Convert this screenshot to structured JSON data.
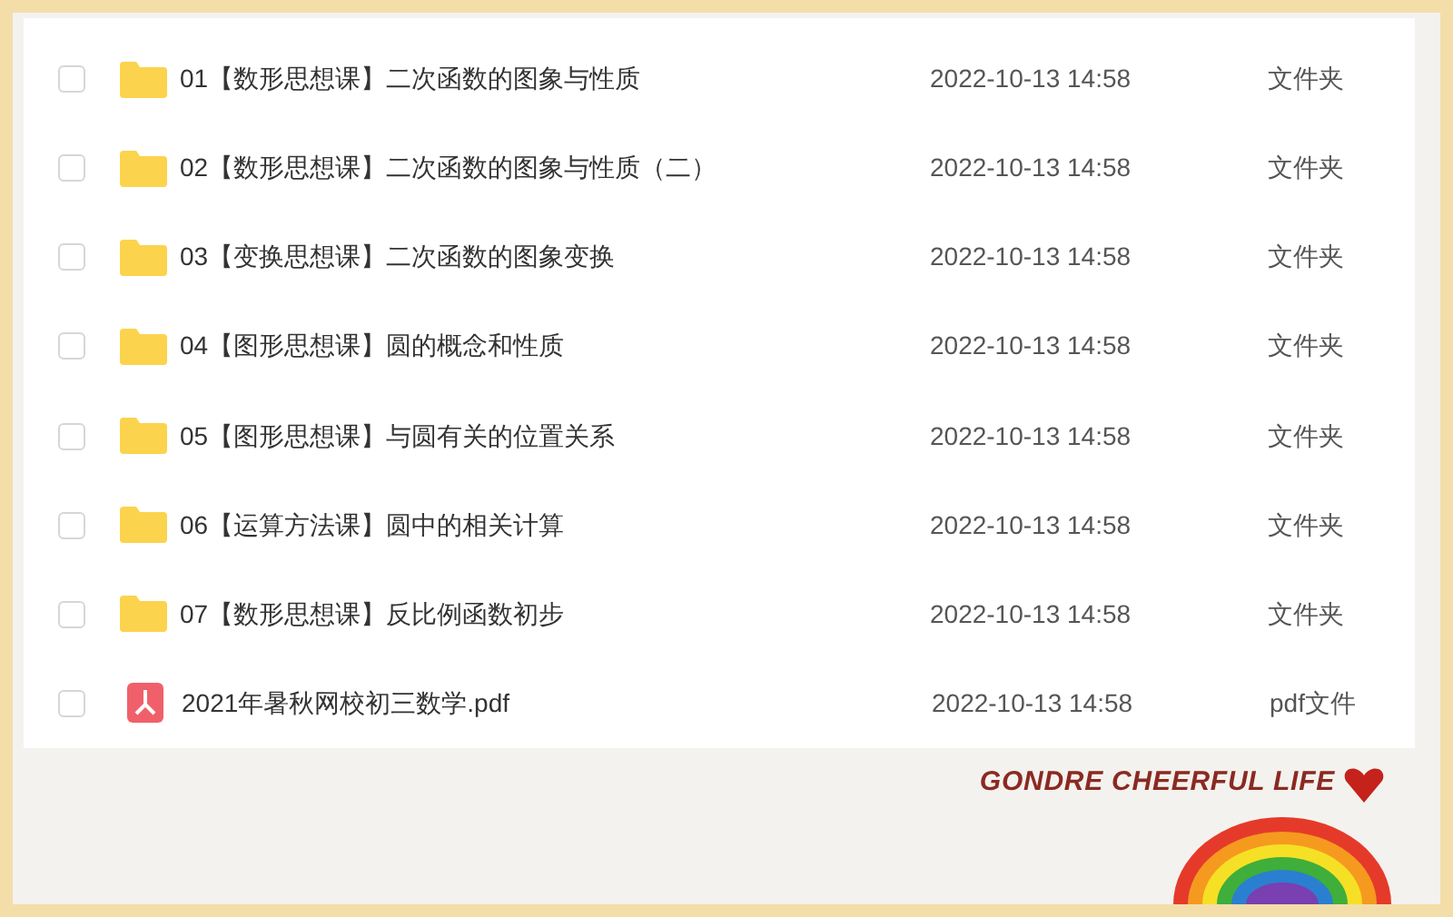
{
  "files": [
    {
      "kind": "folder",
      "name": "01【数形思想课】二次函数的图象与性质",
      "date": "2022-10-13 14:58",
      "type": "文件夹",
      "checked": false
    },
    {
      "kind": "folder",
      "name": "02【数形思想课】二次函数的图象与性质（二）",
      "date": "2022-10-13 14:58",
      "type": "文件夹",
      "checked": false
    },
    {
      "kind": "folder",
      "name": "03【变换思想课】二次函数的图象变换",
      "date": "2022-10-13 14:58",
      "type": "文件夹",
      "checked": false
    },
    {
      "kind": "folder",
      "name": "04【图形思想课】圆的概念和性质",
      "date": "2022-10-13 14:58",
      "type": "文件夹",
      "checked": false
    },
    {
      "kind": "folder",
      "name": "05【图形思想课】与圆有关的位置关系",
      "date": "2022-10-13 14:58",
      "type": "文件夹",
      "checked": false
    },
    {
      "kind": "folder",
      "name": "06【运算方法课】圆中的相关计算",
      "date": "2022-10-13 14:58",
      "type": "文件夹",
      "checked": false
    },
    {
      "kind": "folder",
      "name": "07【数形思想课】反比例函数初步",
      "date": "2022-10-13 14:58",
      "type": "文件夹",
      "checked": false
    },
    {
      "kind": "pdf",
      "name": "2021年暑秋网校初三数学.pdf",
      "date": "2022-10-13 14:58",
      "type": "pdf文件",
      "checked": false
    }
  ],
  "frame_caption": "GONDRE CHEERFUL LIFE"
}
